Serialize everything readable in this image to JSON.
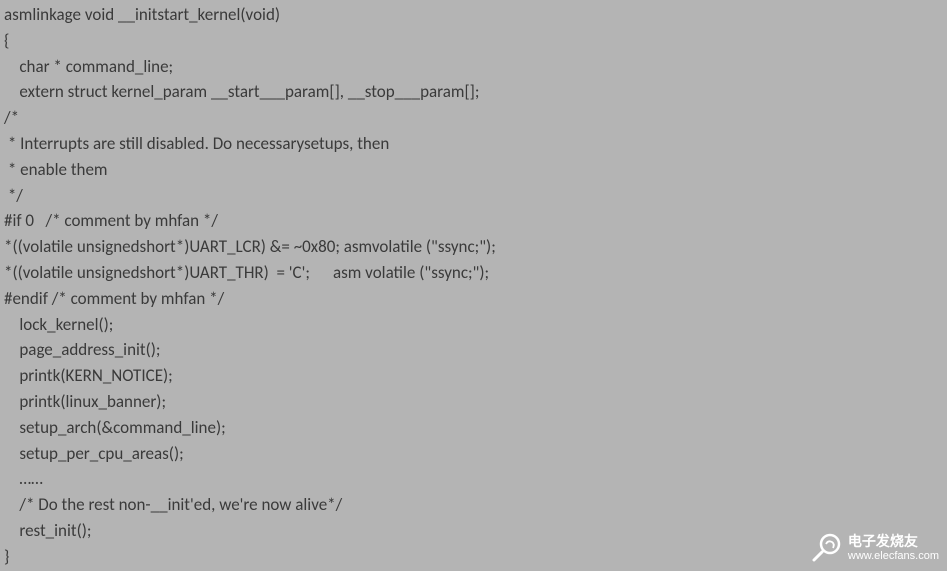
{
  "code": {
    "lines": [
      "asmlinkage void __initstart_kernel(void)",
      "{",
      "    char * command_line;",
      "    extern struct kernel_param __start___param[], __stop___param[];",
      "/*",
      " * Interrupts are still disabled. Do necessarysetups, then",
      " * enable them",
      " */",
      "#if 0   /* comment by mhfan */",
      "*((volatile unsignedshort*)UART_LCR) &= ~0x80; asmvolatile (\"ssync;\");",
      "*((volatile unsignedshort*)UART_THR)  = 'C';      asm volatile (\"ssync;\");",
      "#endif /* comment by mhfan */",
      "    lock_kernel();",
      "    page_address_init();",
      "    printk(KERN_NOTICE);",
      "    printk(linux_banner);",
      "    setup_arch(&command_line);",
      "    setup_per_cpu_areas();",
      "    ……",
      "    /* Do the rest non-__init'ed, we're now alive*/",
      "    rest_init();",
      "}"
    ]
  },
  "watermark": {
    "title": "电子发烧友",
    "url": "www.elecfans.com"
  }
}
